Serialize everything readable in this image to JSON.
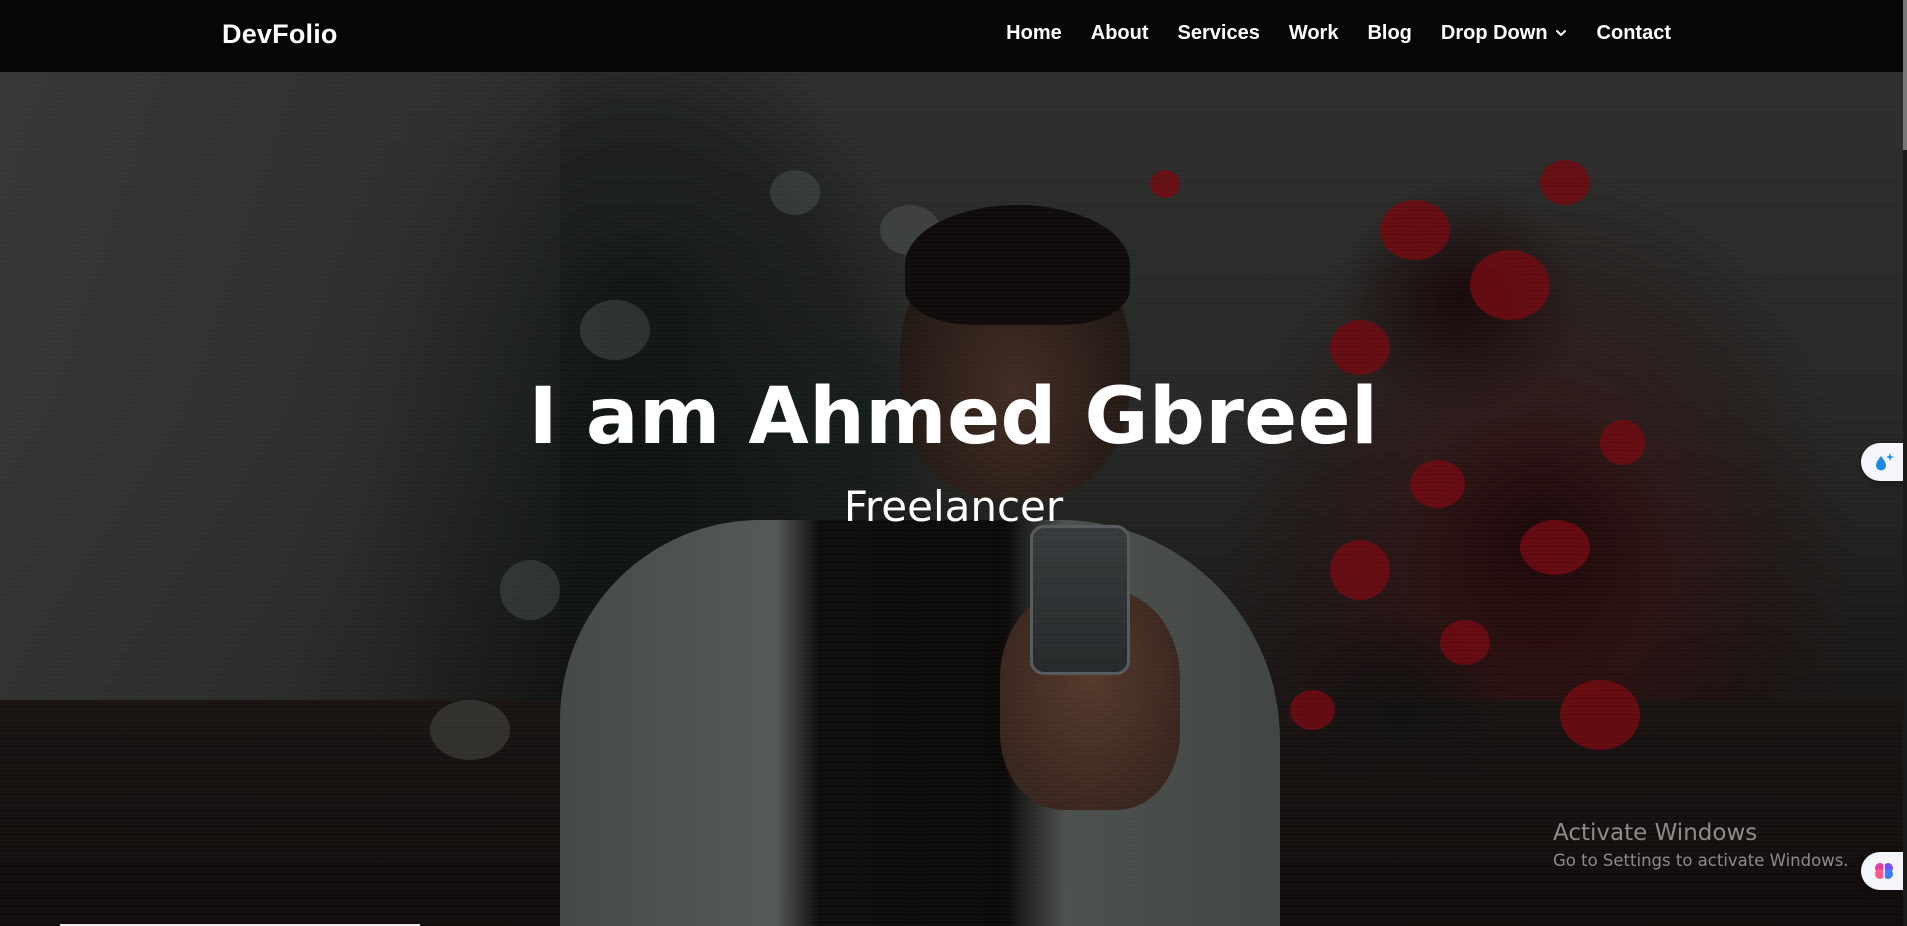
{
  "navbar": {
    "brand": "DevFolio",
    "items": [
      {
        "label": "Home"
      },
      {
        "label": "About"
      },
      {
        "label": "Services"
      },
      {
        "label": "Work"
      },
      {
        "label": "Blog"
      },
      {
        "label": "Drop Down",
        "icon": "chevron-down-icon"
      },
      {
        "label": "Contact"
      }
    ]
  },
  "hero": {
    "title": "I am Ahmed Gbreel",
    "subtitle": "Freelancer"
  },
  "widgets": {
    "top_icon": "sparkle-drop-icon",
    "bottom_icon": "brain-icon"
  },
  "watermark": {
    "title": "Activate Windows",
    "subtitle": "Go to Settings to activate Windows."
  },
  "colors": {
    "navbar_bg": "#060606",
    "text": "#ffffff",
    "flower_red": "#b4121c"
  }
}
